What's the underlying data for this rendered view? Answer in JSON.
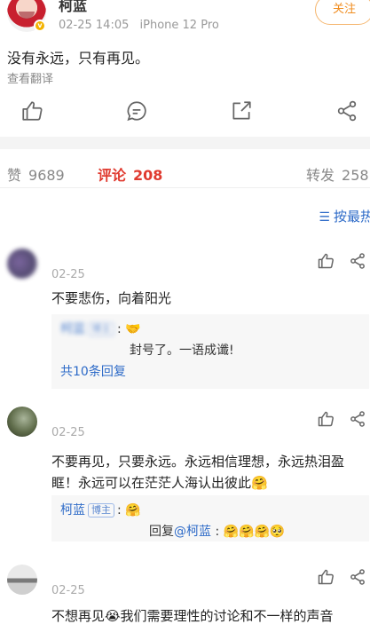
{
  "post": {
    "author": "柯蓝",
    "date": "02-25 14:05",
    "device": "iPhone 12 Pro",
    "follow_label": "关注",
    "text": "没有永远，只有再见。",
    "translate_label": "查看翻译",
    "icons": [
      "thumb-up-icon",
      "comment-icon",
      "share-icon",
      "share-nodes-icon"
    ]
  },
  "tabs": {
    "likes": {
      "label": "赞",
      "count": "9689"
    },
    "comments": {
      "label": "评论",
      "count": "208"
    },
    "reposts": {
      "label": "转发",
      "count": "258"
    }
  },
  "sort": {
    "label": "按最热",
    "icon": "sort-icon"
  },
  "comments": [
    {
      "user": "",
      "date": "02-25",
      "text": "不要悲伤，向着阳光",
      "reply": {
        "author": "柯蓝",
        "badge": "博主",
        "emoji": "🤝",
        "quote": "封号了。一语成谶!",
        "more_label": "共10条回复"
      }
    },
    {
      "user": "",
      "date": "02-25",
      "text": "不要再见，只要永远。永远相信理想，永远热泪盈眶！永远可以在茫茫人海认出彼此🤗",
      "reply": {
        "author": "柯蓝",
        "badge": "博主",
        "emoji": "🤗",
        "second_prefix": "回复",
        "second_mention": "@柯蓝",
        "second_emojis": "🤗🤗🤗🥺"
      }
    },
    {
      "user": "",
      "date": "02-25",
      "text": "不想再见😭我们需要理性的讨论和不一样的声音"
    }
  ]
}
